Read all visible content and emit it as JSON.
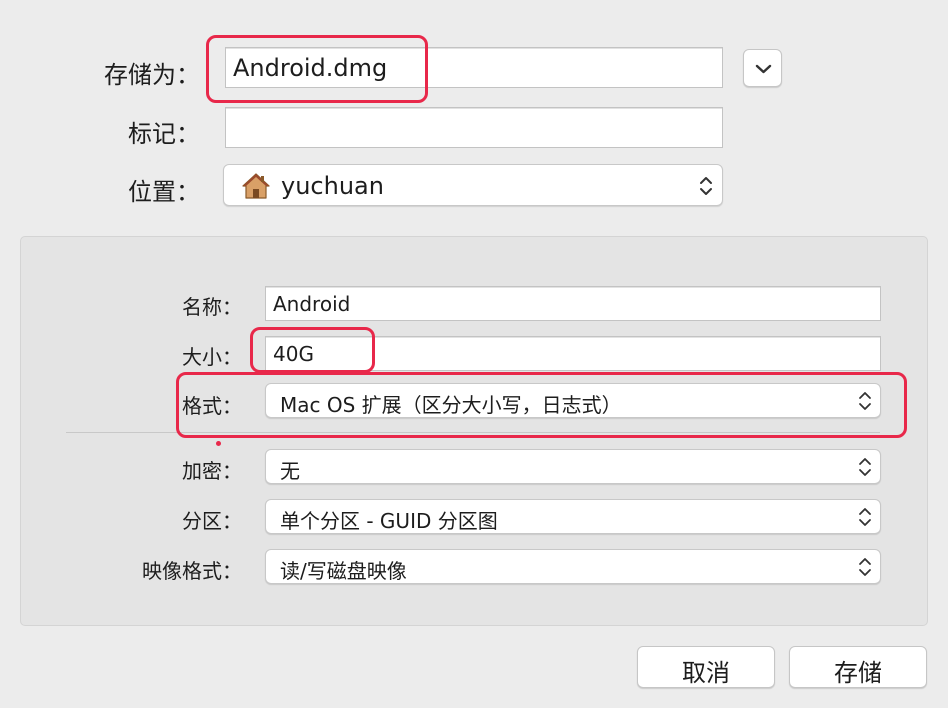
{
  "save_as": {
    "label": "存储为：",
    "value": "Android.dmg"
  },
  "tags": {
    "label": "标记：",
    "value": ""
  },
  "location": {
    "label": "位置：",
    "value": "yuchuan",
    "icon": "home-icon"
  },
  "options": {
    "name": {
      "label": "名称：",
      "value": "Android"
    },
    "size": {
      "label": "大小：",
      "value": "40G"
    },
    "format": {
      "label": "格式：",
      "value": "Mac OS 扩展（区分大小写，日志式）"
    },
    "encryption": {
      "label": "加密：",
      "value": "无"
    },
    "partitions": {
      "label": "分区：",
      "value": "单个分区 - GUID 分区图"
    },
    "image_format": {
      "label": "映像格式：",
      "value": "读/写磁盘映像"
    }
  },
  "buttons": {
    "cancel": "取消",
    "save": "存储"
  },
  "colors": {
    "annotation_red": "#e8284a",
    "panel_bg": "#e4e4e4",
    "window_bg": "#ececec"
  }
}
